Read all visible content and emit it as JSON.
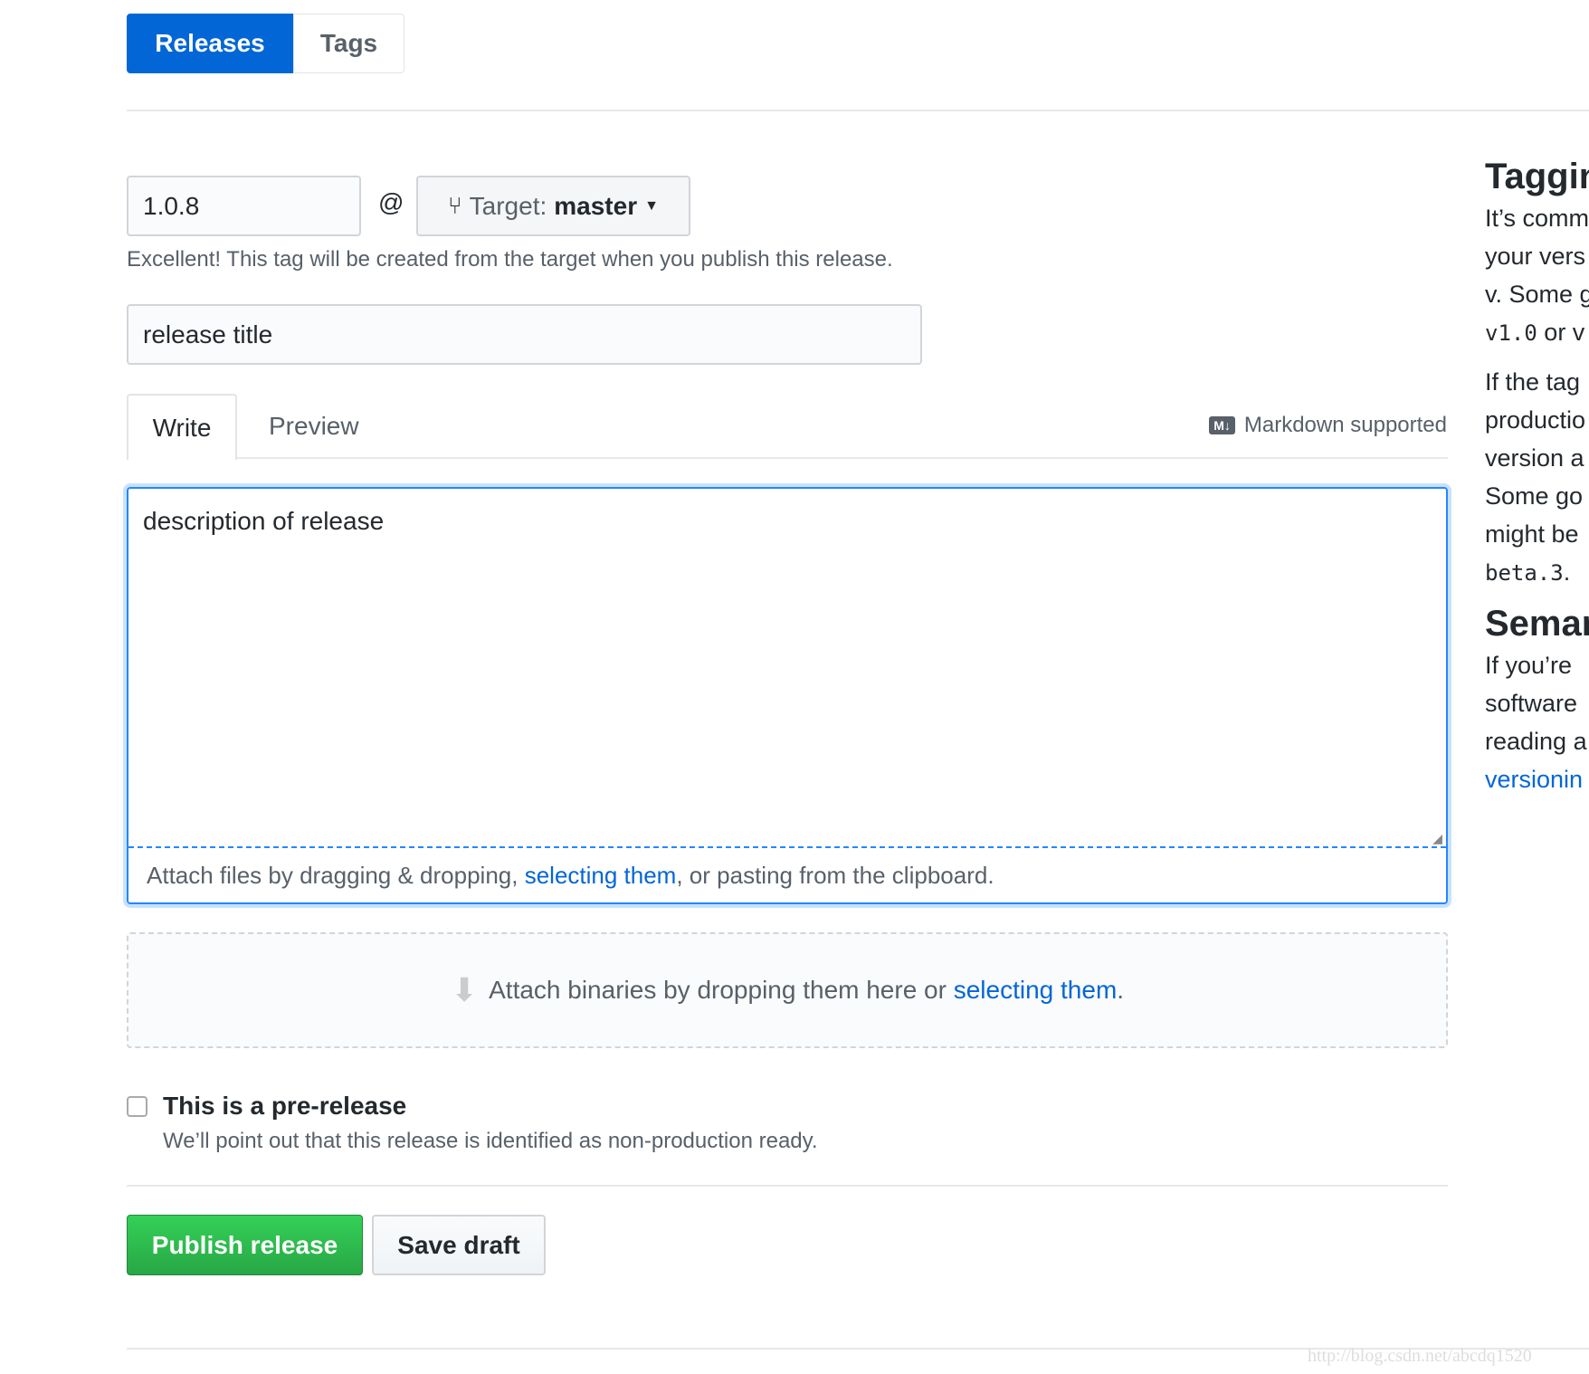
{
  "tabs": {
    "releases": "Releases",
    "tags": "Tags"
  },
  "form": {
    "tag_value": "1.0.8",
    "at": "@",
    "target_label": "Target:",
    "target_branch": "master",
    "tag_hint": "Excellent! This tag will be created from the target when you publish this release.",
    "title_placeholder": "release title",
    "write_tab": "Write",
    "preview_tab": "Preview",
    "markdown_supported": "Markdown supported",
    "description_placeholder": "description of release",
    "attach_files_prefix": "Attach files by dragging & dropping, ",
    "attach_files_link": "selecting them",
    "attach_files_suffix": ", or pasting from the clipboard.",
    "attach_binaries_prefix": "Attach binaries by dropping them here or ",
    "attach_binaries_link": "selecting them",
    "attach_binaries_suffix": ".",
    "prerelease_label": "This is a pre-release",
    "prerelease_checked": false,
    "prerelease_note": "We’ll point out that this release is identified as non-production ready.",
    "publish": "Publish release",
    "save_draft": "Save draft"
  },
  "sidebar": {
    "h1": "Taggin",
    "p1": [
      "It’s comm",
      "your vers",
      "v. Some g"
    ],
    "p1_code": "v1.0",
    "p1_tail": " or v",
    "p2": [
      "If the tag",
      "productio",
      "version a",
      "Some go",
      "might be"
    ],
    "p2_code": "beta.3",
    "p2_tail": ".",
    "h2": "Semar",
    "p3": [
      "If you’re",
      "software",
      "reading a"
    ],
    "p3_link": "versionin"
  },
  "watermark": "http://blog.csdn.net/abcdq1520",
  "colors": {
    "primary": "#0366d6",
    "green": "#28a745",
    "link": "#0366d6"
  }
}
